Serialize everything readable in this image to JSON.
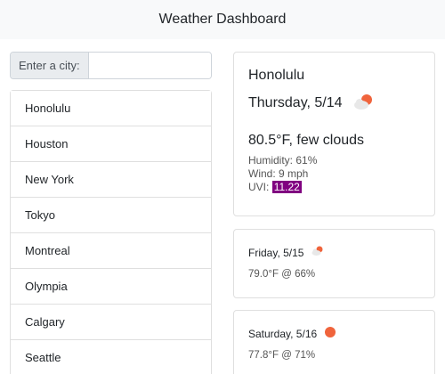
{
  "app": {
    "title": "Weather Dashboard"
  },
  "search": {
    "label": "Enter a city:",
    "value": "",
    "placeholder": ""
  },
  "cities": [
    "Honolulu",
    "Houston",
    "New York",
    "Tokyo",
    "Montreal",
    "Olympia",
    "Calgary",
    "Seattle"
  ],
  "current": {
    "city": "Honolulu",
    "date": "Thursday, 5/14",
    "icon": "few-clouds-icon",
    "summary": "80.5°F, few clouds",
    "humidity": "Humidity: 61%",
    "wind": "Wind: 9 mph",
    "uvi_label": "UVI:",
    "uvi_value": "11.22",
    "uvi_color": "#800080"
  },
  "forecast": [
    {
      "date": "Friday, 5/15",
      "icon": "few-clouds-icon",
      "detail": "79.0°F @ 66%"
    },
    {
      "date": "Saturday, 5/16",
      "icon": "clear-sky-icon",
      "detail": "77.8°F @ 71%"
    }
  ],
  "colors": {
    "sun": "#f0643c",
    "cloud": "#e8e8e8",
    "navbar": "#f8f9fa"
  }
}
